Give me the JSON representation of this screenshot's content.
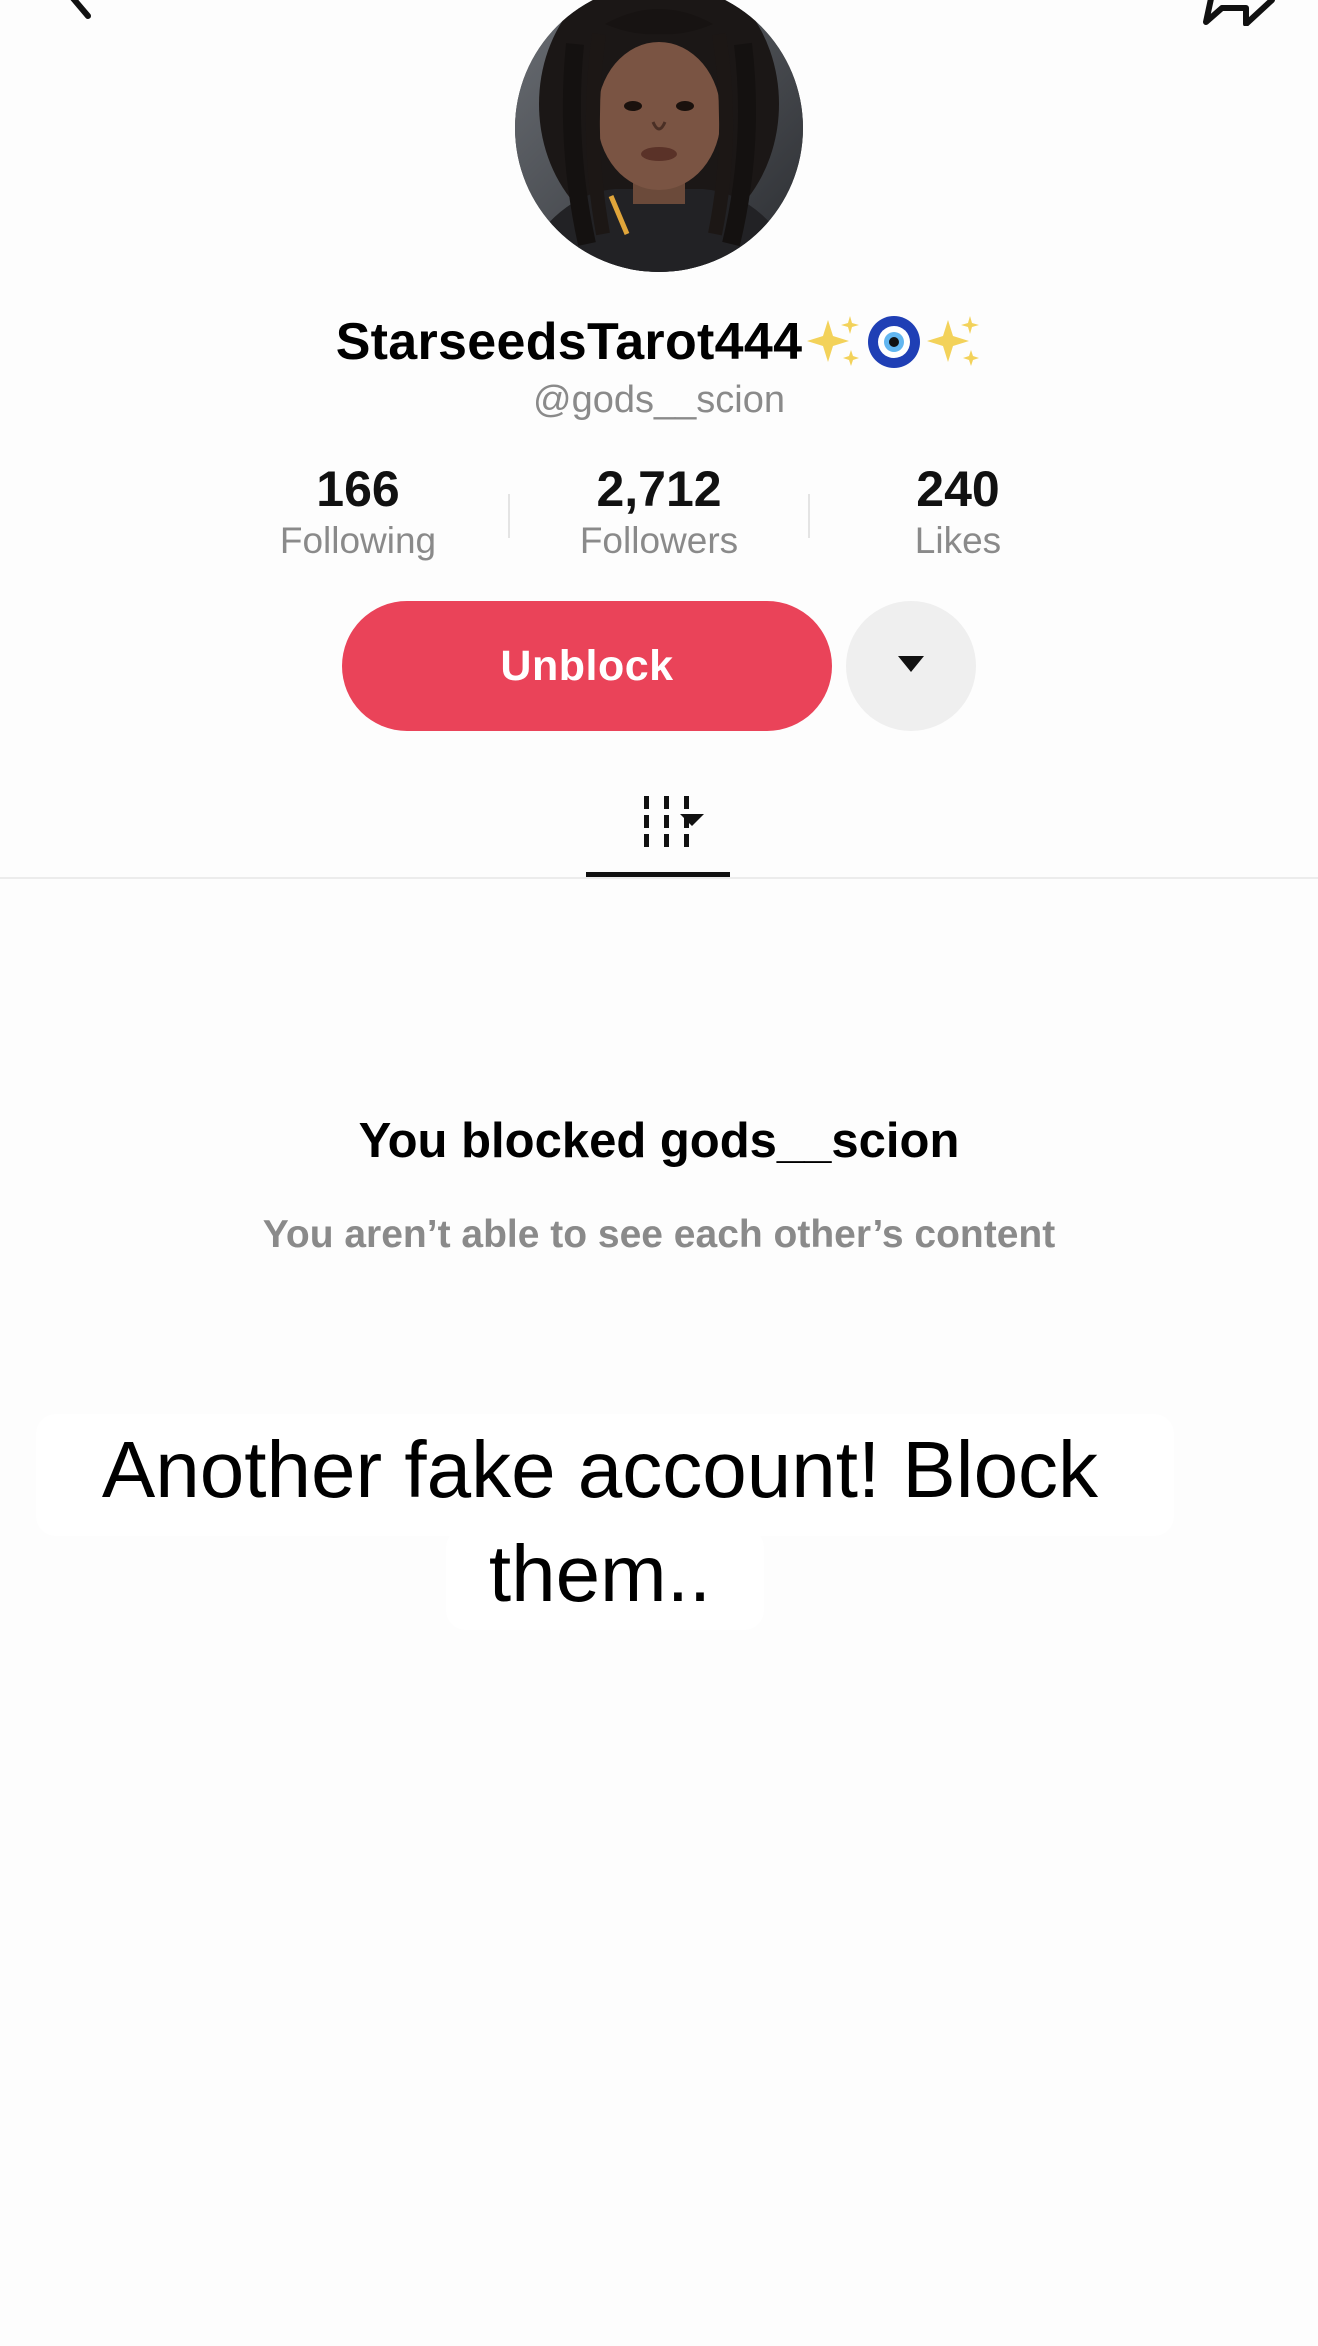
{
  "profile": {
    "display_name": "StarseedsTarot444",
    "name_emojis": [
      "sparkles-icon",
      "nazar-amulet-icon",
      "sparkles-icon"
    ],
    "handle": "@gods__scion",
    "avatar": "profile-photo"
  },
  "stats": [
    {
      "value": "166",
      "label": "Following"
    },
    {
      "value": "2,712",
      "label": "Followers"
    },
    {
      "value": "240",
      "label": "Likes"
    }
  ],
  "actions": {
    "unblock_label": "Unblock",
    "more_icon": "caret-down-icon"
  },
  "tabs": {
    "videos_icon": "grid-icon"
  },
  "blocked": {
    "title": "You blocked gods__scion",
    "subtitle": "You aren’t able to see each other’s content"
  },
  "caption": {
    "line1": "Another fake account! Block",
    "line2": "them.."
  },
  "colors": {
    "unblock": "#ea4359",
    "secondary_text": "#8a8a8a",
    "background": "#fdfdfd"
  }
}
